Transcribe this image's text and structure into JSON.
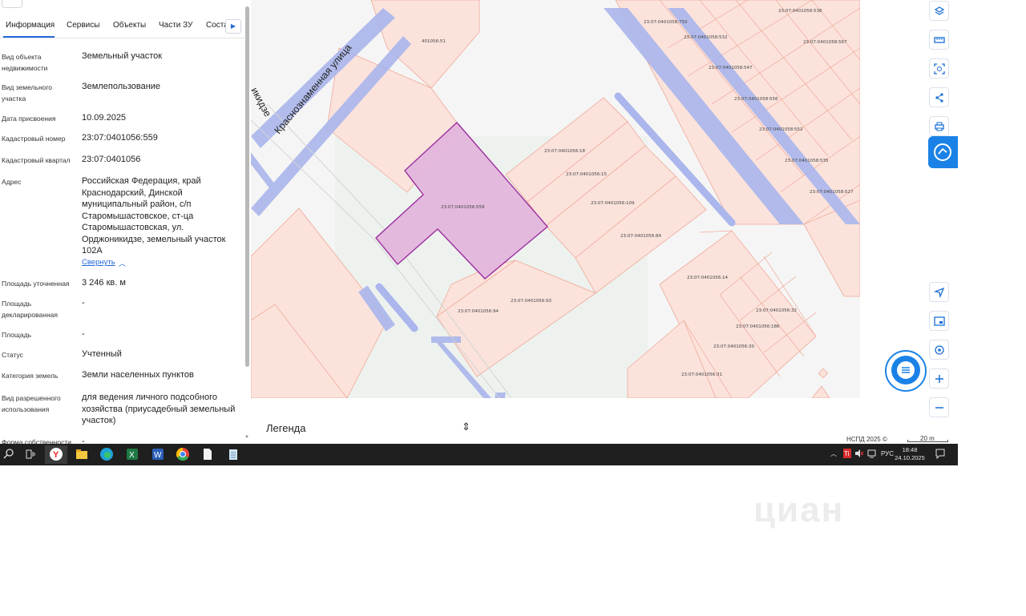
{
  "panel": {
    "tabs": [
      {
        "label": "Информация"
      },
      {
        "label": "Сервисы"
      },
      {
        "label": "Объекты"
      },
      {
        "label": "Части ЗУ"
      },
      {
        "label": "Соста"
      }
    ],
    "rows": [
      {
        "label": "Вид объекта недвижимости",
        "value": "Земельный участок"
      },
      {
        "label": "Вид земельного участка",
        "value": "Землепользование"
      },
      {
        "label": "Дата присвоения",
        "value": "10.09.2025"
      },
      {
        "label": "Кадастровый номер",
        "value": "23:07:0401056:559"
      },
      {
        "label": "Кадастровый квартал",
        "value": "23:07:0401056"
      },
      {
        "label": "Адрес",
        "value": "Российская Федерация, край Краснодарский, Динской муниципальный район, с/п Старомышастовское, ст-ца Старомышастовская, ул. Орджоникидзе, земельный участок 102А"
      },
      {
        "label": "Площадь уточненная",
        "value": "3 246 кв. м"
      },
      {
        "label": "Площадь декларированная",
        "value": "-"
      },
      {
        "label": "Площадь",
        "value": "-"
      },
      {
        "label": "Статус",
        "value": "Учтенный"
      },
      {
        "label": "Категория земель",
        "value": "Земли населенных пунктов"
      },
      {
        "label": "Вид разрешенного использования",
        "value": "для ведения личного подсобного хозяйства (приусадебный земельный участок)"
      },
      {
        "label": "Форма собственности",
        "value": "-"
      }
    ],
    "collapse_label": "Свернуть"
  },
  "map": {
    "street_label": "Краснознаменная улица",
    "street_label_2": "икидзе",
    "highlight_color": "#e3b5dc",
    "parcels": [
      {
        "label": "23:07:0401056:559"
      },
      {
        "label": "23:07:0401056:18"
      },
      {
        "label": "23:07:0401056:15"
      },
      {
        "label": "23:07:0401056:109"
      },
      {
        "label": "23:07:0401056:84"
      },
      {
        "label": "23:07:0401056:93"
      },
      {
        "label": "23:07:0401056:94"
      },
      {
        "label": "23:07:0401056:14"
      },
      {
        "label": "23:07:0401056:32"
      },
      {
        "label": "23:07:0401056:186"
      },
      {
        "label": "23:07:0401056:30"
      },
      {
        "label": "23:07:0401056:31"
      },
      {
        "label": "23:07:0401058:750"
      },
      {
        "label": "23:07:0401058:532"
      },
      {
        "label": "23:07:0401058:536"
      },
      {
        "label": "23:07:0401058:567"
      },
      {
        "label": "23:07:0401058:547"
      },
      {
        "label": "23:07:0401058:556"
      },
      {
        "label": "23:07:0401058:552"
      },
      {
        "label": "23:07:0401058:535"
      },
      {
        "label": "23:07:0401058:527"
      },
      {
        "label": "401056:51"
      }
    ]
  },
  "legend": {
    "title": "Легенда"
  },
  "attribution": "НСПД 2025 ©",
  "scale": "20 m",
  "taskbar": {
    "language": "РУС",
    "time": "18:48",
    "date": "24.10.2025"
  },
  "watermark": "циан"
}
